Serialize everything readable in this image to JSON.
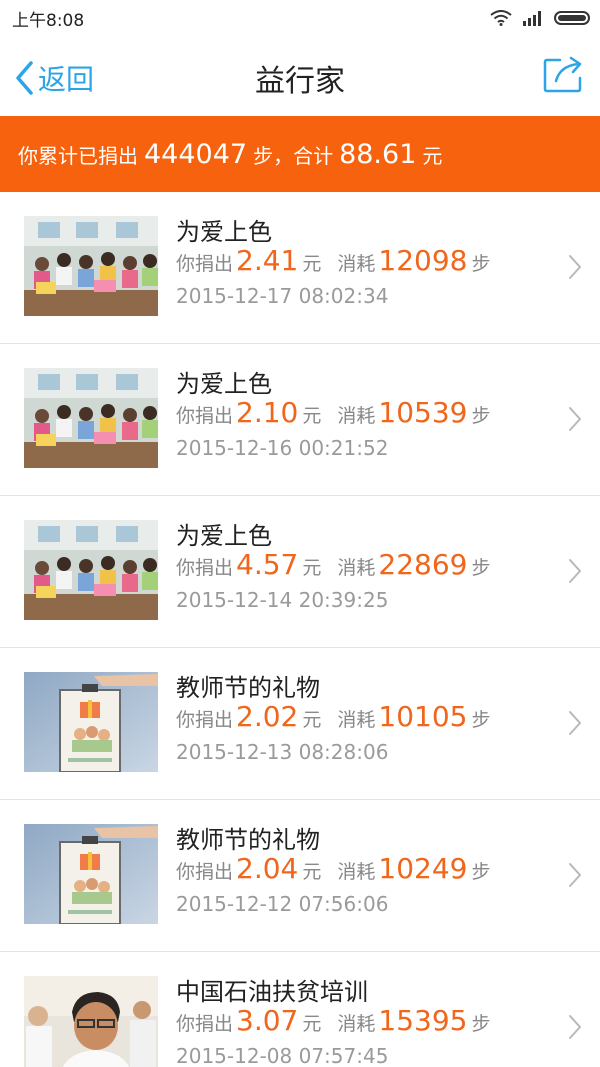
{
  "status_bar": {
    "time": "上午8:08",
    "icons": [
      "wifi-icon",
      "signal-icon",
      "battery-icon"
    ]
  },
  "nav": {
    "back_label": "返回",
    "title": "益行家",
    "share_icon": "share-icon"
  },
  "summary": {
    "prefix": "你累计已捐出",
    "steps": "444047",
    "steps_unit": "步，合计",
    "amount": "88.61",
    "amount_unit": "元"
  },
  "labels": {
    "donated": "你捐出",
    "yuan": "元",
    "consumed": "消耗",
    "steps": "步"
  },
  "colors": {
    "accent_blue": "#2ca5e8",
    "banner_orange": "#f7620e",
    "number_orange": "#f0661c"
  },
  "items": [
    {
      "title": "为爱上色",
      "amount": "2.41",
      "steps": "12098",
      "date": "2015-12-17 08:02:34",
      "thumb": "classroom"
    },
    {
      "title": "为爱上色",
      "amount": "2.10",
      "steps": "10539",
      "date": "2015-12-16 00:21:52",
      "thumb": "classroom"
    },
    {
      "title": "为爱上色",
      "amount": "4.57",
      "steps": "22869",
      "date": "2015-12-14 20:39:25",
      "thumb": "classroom"
    },
    {
      "title": "教师节的礼物",
      "amount": "2.02",
      "steps": "10105",
      "date": "2015-12-13 08:28:06",
      "thumb": "gift-box"
    },
    {
      "title": "教师节的礼物",
      "amount": "2.04",
      "steps": "10249",
      "date": "2015-12-12 07:56:06",
      "thumb": "gift-box"
    },
    {
      "title": "中国石油扶贫培训",
      "amount": "3.07",
      "steps": "15395",
      "date": "2015-12-08 07:57:45",
      "thumb": "man-portrait"
    }
  ]
}
